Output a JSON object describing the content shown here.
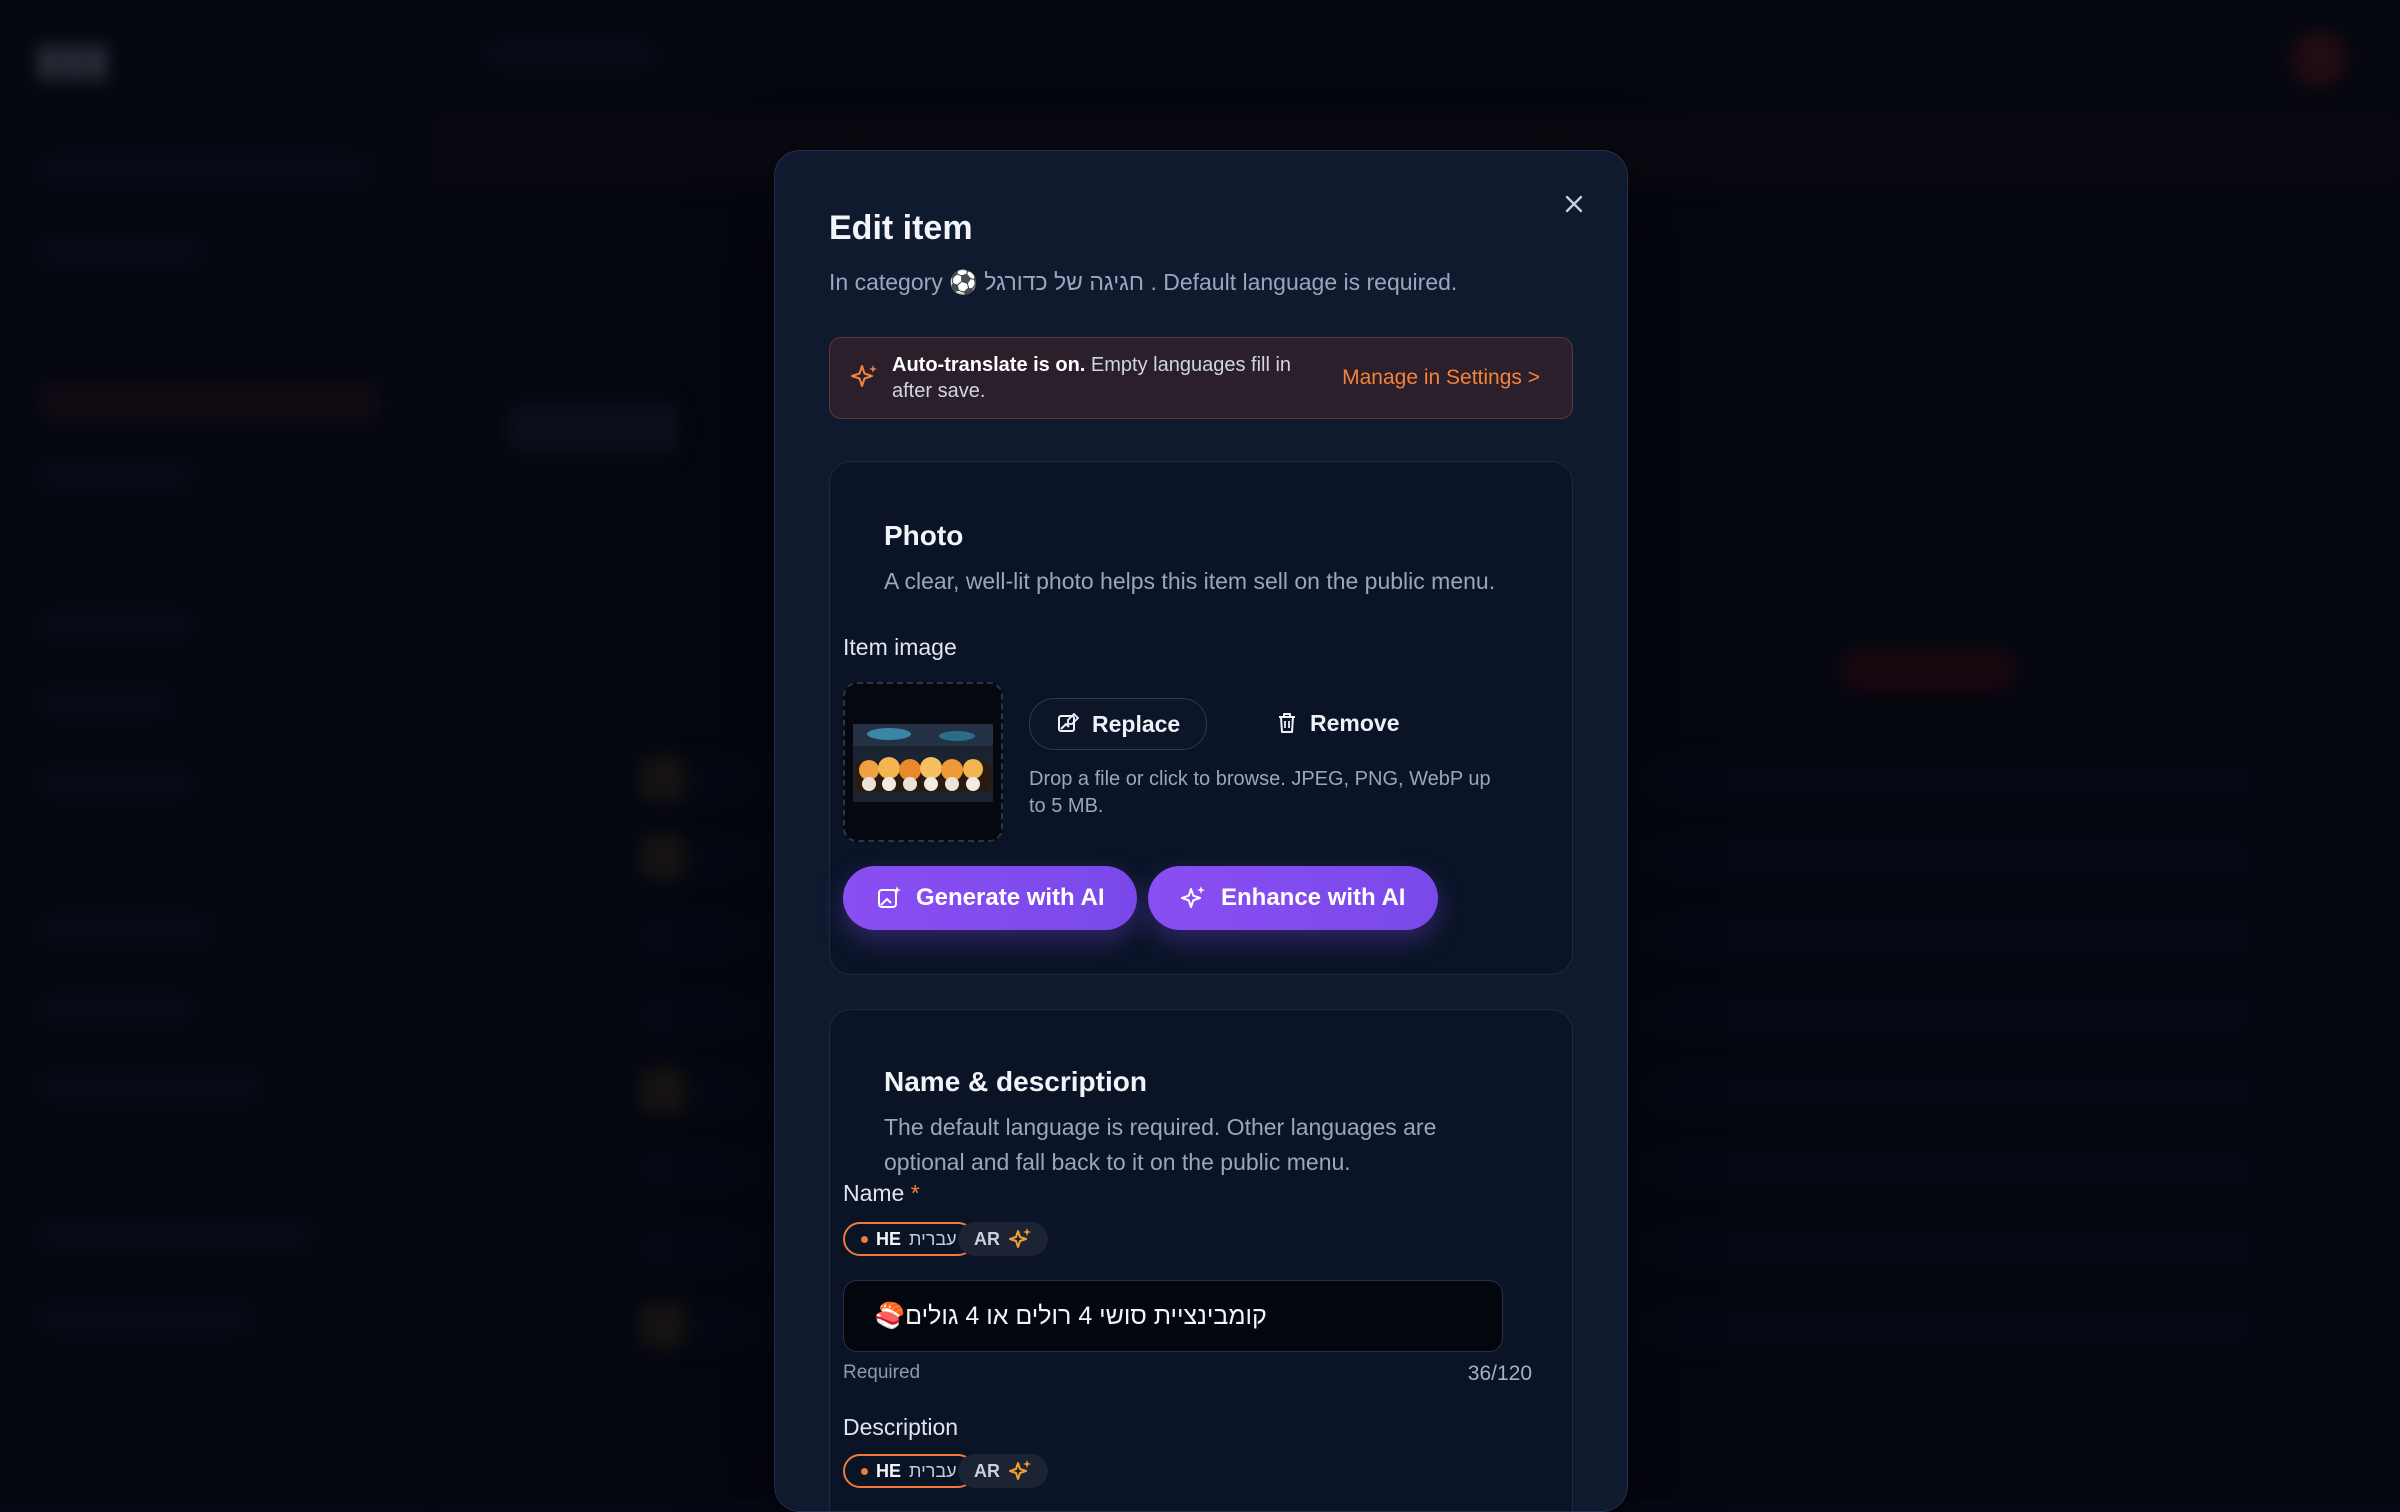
{
  "modal": {
    "title": "Edit item",
    "subtitle_prefix": "In category",
    "category": "חגיגה של כדורגל ⚽",
    "subtitle_suffix": ". Default language is required.",
    "notice": {
      "bold": "Auto-translate is on.",
      "text": "Empty languages fill in after save.",
      "link": "Manage in Settings >"
    },
    "photo": {
      "heading": "Photo",
      "description": "A clear, well-lit photo helps this item sell on the public menu.",
      "image_label": "Item image",
      "replace_label": "Replace",
      "remove_label": "Remove",
      "hint": "Drop a file or click to browse. JPEG, PNG, WebP up to 5 MB.",
      "generate_label": "Generate with AI",
      "enhance_label": "Enhance with AI"
    },
    "name_section": {
      "heading": "Name & description",
      "description": "The default language is required. Other languages are optional and fall back to it on the public menu.",
      "name_label": "Name",
      "required_mark": "*",
      "languages": [
        {
          "code": "HE",
          "name": "עברית"
        },
        {
          "code": "AR"
        }
      ],
      "name_value": "קומבינציית סושי 4 רולים או 4 גולים🍣",
      "required_text": "Required",
      "char_count": "36/120",
      "description_label": "Description"
    }
  },
  "colors": {
    "accent": "#f5823a",
    "ai_purple": "#8a4ef3",
    "modal_bg": "#0f1a2e"
  }
}
